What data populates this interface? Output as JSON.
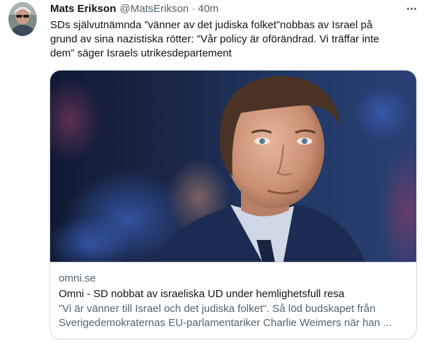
{
  "author": {
    "display_name": "Mats Erikson",
    "handle": "@MatsErikson",
    "separator": "·",
    "time": "40m"
  },
  "tweet": {
    "text": "SDs självutnämnda ”vänner av det judiska folket”nobbas av Israel på\ngrund av sina nazistiska rötter: ”Vår policy är oförändrad. Vi träffar inte\ndem” säger Israels utrikesdepartement"
  },
  "card": {
    "domain": "omni.se",
    "title": "Omni - SD nobbat av israeliska UD under hemlighetsfull resa",
    "description": "”Vi är vänner till Israel och det judiska folket”. Så löd budskapet från Sverigedemokraternas EU-parlamentariker Charlie Weimers när han ..."
  },
  "icons": {
    "more": "more-horizontal-icon",
    "avatar": "profile-avatar"
  }
}
